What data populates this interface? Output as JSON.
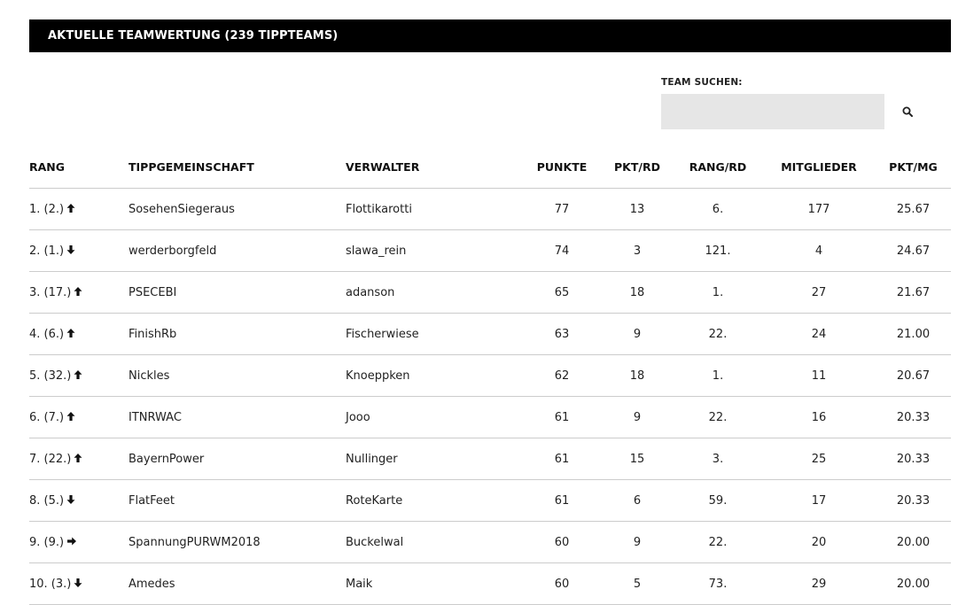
{
  "header": {
    "title": "AKTUELLE TEAMWERTUNG (239 TIPPTEAMS)"
  },
  "search": {
    "label": "TEAM SUCHEN:",
    "value": "",
    "placeholder": ""
  },
  "table": {
    "columns": [
      "RANG",
      "TIPPGEMEINSCHAFT",
      "VERWALTER",
      "PUNKTE",
      "PKT/RD",
      "RANG/RD",
      "MITGLIEDER",
      "PKT/MG"
    ],
    "rows": [
      {
        "rank": "1. (2.)",
        "trend": "up",
        "team": "SosehenSiegeraus",
        "manager": "Flottikarotti",
        "points": "77",
        "pts_round": "13",
        "rank_round": "6.",
        "members": "177",
        "pts_member": "25.67"
      },
      {
        "rank": "2. (1.)",
        "trend": "down",
        "team": "werderborgfeld",
        "manager": "slawa_rein",
        "points": "74",
        "pts_round": "3",
        "rank_round": "121.",
        "members": "4",
        "pts_member": "24.67"
      },
      {
        "rank": "3. (17.)",
        "trend": "up",
        "team": "PSECEBI",
        "manager": "adanson",
        "points": "65",
        "pts_round": "18",
        "rank_round": "1.",
        "members": "27",
        "pts_member": "21.67"
      },
      {
        "rank": "4. (6.)",
        "trend": "up",
        "team": "FinishRb",
        "manager": "Fischerwiese",
        "points": "63",
        "pts_round": "9",
        "rank_round": "22.",
        "members": "24",
        "pts_member": "21.00"
      },
      {
        "rank": "5. (32.)",
        "trend": "up",
        "team": "Nickles",
        "manager": "Knoeppken",
        "points": "62",
        "pts_round": "18",
        "rank_round": "1.",
        "members": "11",
        "pts_member": "20.67"
      },
      {
        "rank": "6. (7.)",
        "trend": "up",
        "team": "ITNRWAC",
        "manager": "Jooo",
        "points": "61",
        "pts_round": "9",
        "rank_round": "22.",
        "members": "16",
        "pts_member": "20.33"
      },
      {
        "rank": "7. (22.)",
        "trend": "up",
        "team": "BayernPower",
        "manager": "Nullinger",
        "points": "61",
        "pts_round": "15",
        "rank_round": "3.",
        "members": "25",
        "pts_member": "20.33"
      },
      {
        "rank": "8. (5.)",
        "trend": "down",
        "team": "FlatFeet",
        "manager": "RoteKarte",
        "points": "61",
        "pts_round": "6",
        "rank_round": "59.",
        "members": "17",
        "pts_member": "20.33"
      },
      {
        "rank": "9. (9.)",
        "trend": "same",
        "team": "SpannungPURWM2018",
        "manager": "Buckelwal",
        "points": "60",
        "pts_round": "9",
        "rank_round": "22.",
        "members": "20",
        "pts_member": "20.00"
      },
      {
        "rank": "10. (3.)",
        "trend": "down",
        "team": "Amedes",
        "manager": "Maik",
        "points": "60",
        "pts_round": "5",
        "rank_round": "73.",
        "members": "29",
        "pts_member": "20.00"
      }
    ]
  },
  "icons": {
    "search": "search-icon",
    "up": "arrow-up-icon",
    "down": "arrow-down-icon",
    "same": "arrow-right-icon"
  },
  "colors": {
    "header_bg": "#000000",
    "header_text": "#ffffff",
    "search_bg": "#e6e6e6",
    "row_border": "#cccccc"
  }
}
